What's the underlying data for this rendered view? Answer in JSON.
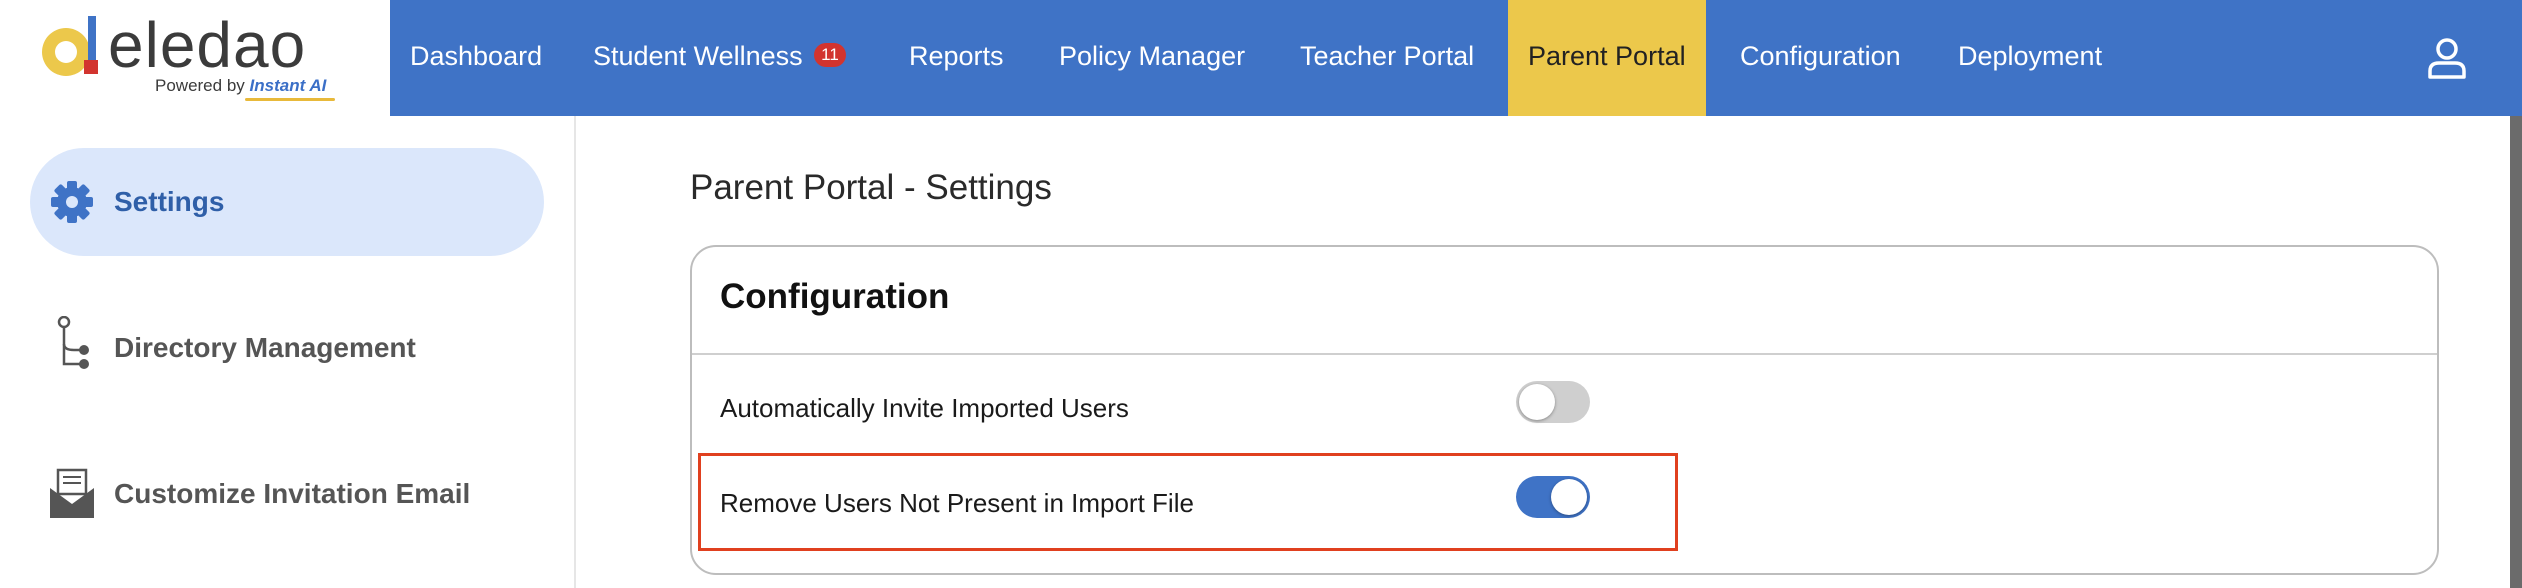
{
  "brand": {
    "name": "eledao",
    "powered_prefix": "Powered by",
    "powered_brand": "Instant AI"
  },
  "nav": {
    "items": [
      {
        "label": "Dashboard"
      },
      {
        "label": "Student Wellness",
        "badge": "11"
      },
      {
        "label": "Reports"
      },
      {
        "label": "Policy Manager"
      },
      {
        "label": "Teacher Portal"
      },
      {
        "label": "Parent Portal",
        "active": true
      },
      {
        "label": "Configuration"
      },
      {
        "label": "Deployment"
      }
    ],
    "user_icon": "user-icon"
  },
  "sidebar": {
    "items": [
      {
        "label": "Settings",
        "icon": "gear-icon",
        "active": true
      },
      {
        "label": "Directory Management",
        "icon": "directory-tree-icon"
      },
      {
        "label": "Customize Invitation Email",
        "icon": "mail-icon"
      }
    ]
  },
  "main": {
    "title": "Parent Portal - Settings",
    "card": {
      "title": "Configuration",
      "rows": [
        {
          "label": "Automatically Invite Imported Users",
          "enabled": false
        },
        {
          "label": "Remove Users Not Present in Import File",
          "enabled": true,
          "highlighted": true
        }
      ]
    }
  },
  "colors": {
    "nav_bg": "#3f73c6",
    "nav_active_bg": "#ecc84b",
    "sidebar_active_bg": "#dbe7fb",
    "badge": "#d2342f",
    "toggle_on": "#3f73c6",
    "highlight_border": "#e0401f"
  }
}
